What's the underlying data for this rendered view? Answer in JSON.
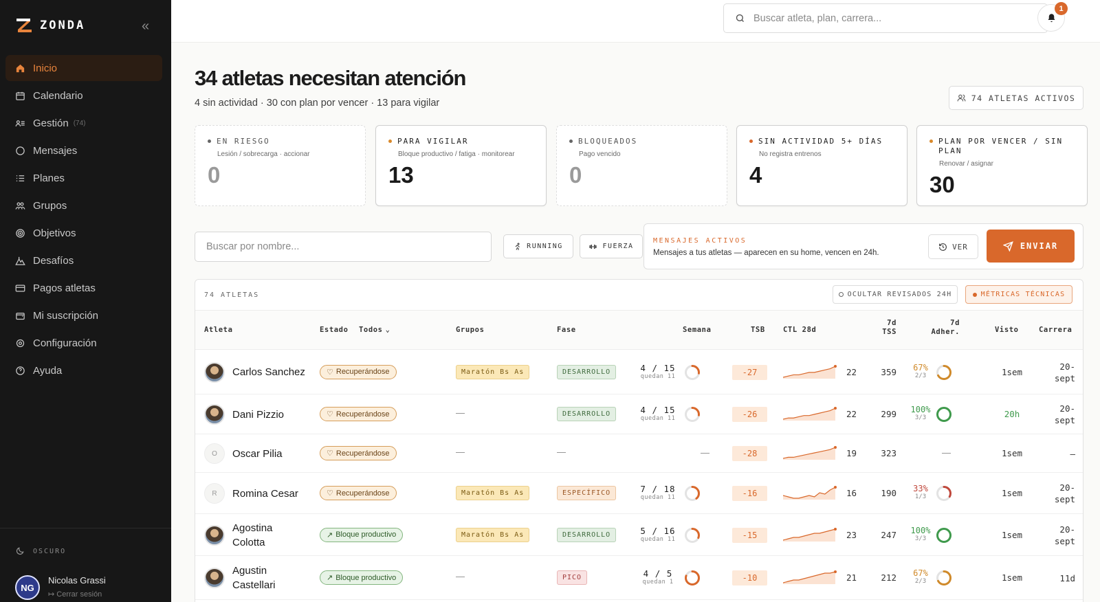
{
  "app": {
    "brand": "ZONDA",
    "accent": "#d9682b"
  },
  "sidebar": {
    "items": [
      {
        "label": "Inicio",
        "icon": "home-icon",
        "active": true
      },
      {
        "label": "Calendario",
        "icon": "calendar-icon"
      },
      {
        "label": "Gestión",
        "icon": "users-list-icon",
        "badge": "(74)"
      },
      {
        "label": "Mensajes",
        "icon": "chat-icon"
      },
      {
        "label": "Planes",
        "icon": "list-icon"
      },
      {
        "label": "Grupos",
        "icon": "groups-icon"
      },
      {
        "label": "Objetivos",
        "icon": "target-icon"
      },
      {
        "label": "Desafíos",
        "icon": "mountain-icon"
      },
      {
        "label": "Pagos atletas",
        "icon": "card-icon"
      },
      {
        "label": "Mi suscripción",
        "icon": "wallet-icon"
      },
      {
        "label": "Configuración",
        "icon": "gear-icon"
      },
      {
        "label": "Ayuda",
        "icon": "help-icon"
      }
    ],
    "theme_label": "OSCURO",
    "user": {
      "name": "Nicolas Grassi",
      "logout": "Cerrar sesión",
      "initials": "NG"
    }
  },
  "topbar": {
    "search_placeholder": "Buscar atleta, plan, carrera...",
    "notifications": "1"
  },
  "header": {
    "title": "34 atletas necesitan atención",
    "subtitle": "4 sin actividad · 30 con plan por vencer · 13 para vigilar",
    "active_button": "74 ATLETAS ACTIVOS"
  },
  "cards": [
    {
      "title": "EN RIESGO",
      "desc": "Lesión / sobrecarga · accionar",
      "value": "0",
      "dot": "#666666"
    },
    {
      "title": "PARA VIGILAR",
      "desc": "Bloque productivo / fatiga · monitorear",
      "value": "13",
      "dot": "#d9892b"
    },
    {
      "title": "BLOQUEADOS",
      "desc": "Pago vencido",
      "value": "0",
      "dot": "#666666"
    },
    {
      "title": "SIN ACTIVIDAD 5+ DÍAS",
      "desc": "No registra entrenos",
      "value": "4",
      "dot": "#d9682b"
    },
    {
      "title": "PLAN POR VENCER / SIN PLAN",
      "desc": "Renovar / asignar",
      "value": "30",
      "dot": "#d9892b"
    }
  ],
  "filters": {
    "name_placeholder": "Buscar por nombre...",
    "running": "RUNNING",
    "fuerza": "FUERZA"
  },
  "messages": {
    "title": "MENSAJES ACTIVOS",
    "desc": "Mensajes a tus atletas — aparecen en su home, vencen en 24h.",
    "ver": "VER",
    "enviar": "ENVIAR"
  },
  "table": {
    "count": "74 ATLETAS",
    "hide_reviewed": "OCULTAR REVISADOS 24H",
    "metrics": "MÉTRICAS TÉCNICAS",
    "headers": {
      "atleta": "Atleta",
      "estado": "Estado",
      "todos": "Todos",
      "grupos": "Grupos",
      "fase": "Fase",
      "semana": "Semana",
      "tsb": "TSB",
      "ctl": "CTL 28d",
      "tss1": "7d",
      "tss2": "TSS",
      "adh1": "7d",
      "adh2": "Adher.",
      "visto": "Visto",
      "carrera": "Carrera"
    },
    "rows": [
      {
        "name": "Carlos Sanchez",
        "avatar": "photo",
        "estado": "Recuperándose",
        "estado_type": "rec",
        "grupo": "Maratón Bs As",
        "fase": "DESARROLLO",
        "fase_type": "des",
        "semana": "4 / 15",
        "semana_sub": "quedan 11",
        "semana_frac": 0.27,
        "tsb": "-27",
        "ctl_trend": [
          3,
          4,
          5,
          5,
          6,
          7,
          7,
          8,
          9,
          10,
          12
        ],
        "ctl": "22",
        "tss": "359",
        "adh": "67%",
        "adh_sub": "2/3",
        "adh_frac": 0.67,
        "adh_color": "#d08a2a",
        "visto": "1sem",
        "visto_color": "#333333",
        "carrera": "20-\nsept"
      },
      {
        "name": "Dani Pizzio",
        "avatar": "photo",
        "estado": "Recuperándose",
        "estado_type": "rec",
        "grupo": "—",
        "fase": "DESARROLLO",
        "fase_type": "des",
        "semana": "4 / 15",
        "semana_sub": "quedan 11",
        "semana_frac": 0.27,
        "tsb": "-26",
        "ctl_trend": [
          3,
          4,
          4,
          5,
          6,
          6,
          7,
          8,
          9,
          10,
          12
        ],
        "ctl": "22",
        "tss": "299",
        "adh": "100%",
        "adh_sub": "3/3",
        "adh_frac": 1,
        "adh_color": "#3f9a4c",
        "visto": "20h",
        "visto_color": "#3f9a4c",
        "carrera": "20-\nsept"
      },
      {
        "name": "Oscar Pilia",
        "avatar": "O",
        "estado": "Recuperándose",
        "estado_type": "rec",
        "grupo": "—",
        "fase": "—",
        "fase_type": "none",
        "semana": "—",
        "semana_sub": "",
        "semana_frac": -1,
        "tsb": "-28",
        "ctl_trend": [
          2,
          3,
          3,
          4,
          5,
          6,
          7,
          8,
          9,
          10,
          12
        ],
        "ctl": "19",
        "tss": "323",
        "adh": "—",
        "adh_sub": "",
        "adh_frac": -1,
        "adh_color": "#888888",
        "visto": "1sem",
        "visto_color": "#333333",
        "carrera": "—"
      },
      {
        "name": "Romina Cesar",
        "avatar": "R",
        "estado": "Recuperándose",
        "estado_type": "rec",
        "grupo": "Maratón Bs As",
        "fase": "ESPECÍFICO",
        "fase_type": "esp",
        "semana": "7 / 18",
        "semana_sub": "quedan 11",
        "semana_frac": 0.39,
        "tsb": "-16",
        "ctl_trend": [
          5,
          4,
          3,
          3,
          4,
          5,
          4,
          7,
          6,
          9,
          11
        ],
        "ctl": "16",
        "tss": "190",
        "adh": "33%",
        "adh_sub": "1/3",
        "adh_frac": 0.33,
        "adh_color": "#c0483c",
        "visto": "1sem",
        "visto_color": "#333333",
        "carrera": "20-\nsept"
      },
      {
        "name": "Agostina Colotta",
        "avatar": "photo",
        "estado": "Bloque productivo",
        "estado_type": "bp",
        "grupo": "Maratón Bs As",
        "fase": "DESARROLLO",
        "fase_type": "des",
        "semana": "5 / 16",
        "semana_sub": "quedan 11",
        "semana_frac": 0.31,
        "tsb": "-15",
        "ctl_trend": [
          3,
          4,
          5,
          5,
          6,
          7,
          8,
          8,
          9,
          10,
          11
        ],
        "ctl": "23",
        "tss": "247",
        "adh": "100%",
        "adh_sub": "3/3",
        "adh_frac": 1,
        "adh_color": "#3f9a4c",
        "visto": "1sem",
        "visto_color": "#333333",
        "carrera": "20-\nsept"
      },
      {
        "name": "Agustin Castellari",
        "avatar": "photo",
        "estado": "Bloque productivo",
        "estado_type": "bp",
        "grupo": "—",
        "fase": "PICO",
        "fase_type": "pico",
        "semana": "4 / 5",
        "semana_sub": "quedan 1",
        "semana_frac": 0.8,
        "tsb": "-10",
        "ctl_trend": [
          3,
          4,
          5,
          5,
          6,
          7,
          8,
          9,
          10,
          10,
          11
        ],
        "ctl": "21",
        "tss": "212",
        "adh": "67%",
        "adh_sub": "2/3",
        "adh_frac": 0.67,
        "adh_color": "#d08a2a",
        "visto": "1sem",
        "visto_color": "#333333",
        "carrera": "11d"
      }
    ]
  }
}
